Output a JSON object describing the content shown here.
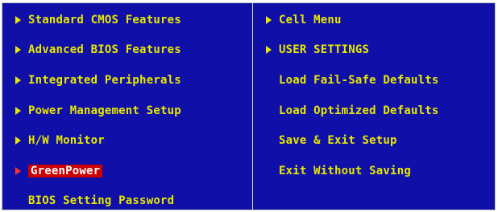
{
  "left_menu": [
    {
      "label": "Standard CMOS Features",
      "arrow": true
    },
    {
      "label": "Advanced BIOS Features",
      "arrow": true
    },
    {
      "label": "Integrated Peripherals",
      "arrow": true
    },
    {
      "label": "Power Management Setup",
      "arrow": true
    },
    {
      "label": "H/W Monitor",
      "arrow": true
    },
    {
      "label": "GreenPower",
      "arrow": true,
      "selected": true
    },
    {
      "label": "BIOS Setting Password",
      "arrow": false
    }
  ],
  "right_menu": [
    {
      "label": "Cell Menu",
      "arrow": true
    },
    {
      "label": "USER SETTINGS",
      "arrow": true
    },
    {
      "label": "Load Fail-Safe Defaults",
      "arrow": false
    },
    {
      "label": "Load Optimized Defaults",
      "arrow": false
    },
    {
      "label": "Save & Exit Setup",
      "arrow": false
    },
    {
      "label": "Exit Without Saving",
      "arrow": false
    }
  ],
  "colors": {
    "background": "#1010a8",
    "text": "#e8e800",
    "selected_background": "#cc0000",
    "selected_text": "#ffffff"
  },
  "icons": {
    "submenu": "submenu-arrow-icon"
  }
}
